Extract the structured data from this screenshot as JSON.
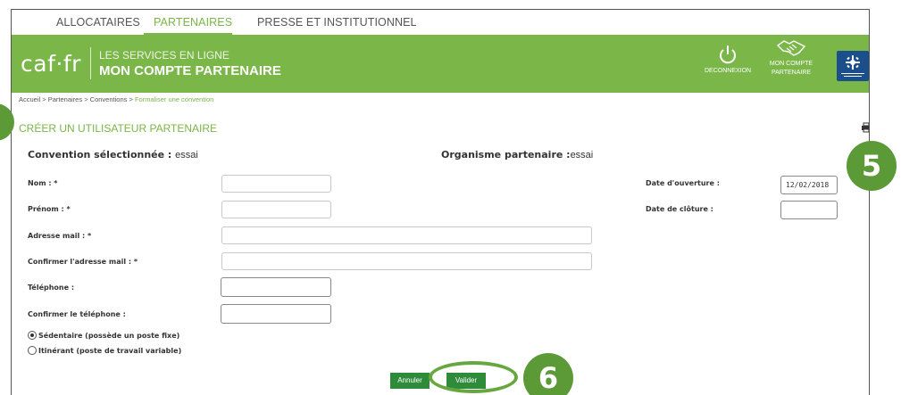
{
  "topnav": {
    "items": [
      {
        "label": "ALLOCATAIRES",
        "active": false
      },
      {
        "label": "PARTENAIRES",
        "active": true
      },
      {
        "label": "PRESSE ET INSTITUTIONNEL",
        "active": false
      }
    ]
  },
  "banner": {
    "logo": "caf·fr",
    "subtitle_small": "LES SERVICES EN LIGNE",
    "subtitle_big": "MON COMPTE PARTENAIRE",
    "logout_label": "DECONNEXION",
    "account_label_1": "MON COMPTE",
    "account_label_2": "PARTENAIRE",
    "brand_color": "#7ab648"
  },
  "breadcrumb": {
    "items": [
      "Accueil",
      "Partenaires",
      "Conventions"
    ],
    "separator": " > ",
    "current": "Formaliser une convention"
  },
  "page": {
    "title": "CRÉER UN UTILISATEUR PARTENAIRE",
    "convention_label": "Convention sélectionnée :",
    "convention_value": "essai",
    "organisme_label": "Organisme partenaire :",
    "organisme_value": "essai"
  },
  "form": {
    "nom_label": "Nom : *",
    "nom_value": "",
    "prenom_label": "Prénom : *",
    "prenom_value": "",
    "email_label": "Adresse mail : *",
    "email_value": "",
    "email_confirm_label": "Confirmer l'adresse mail : *",
    "email_confirm_value": "",
    "tel_label": "Téléphone :",
    "tel_value": "",
    "tel_confirm_label": "Confirmer le téléphone :",
    "tel_confirm_value": "",
    "date_ouverture_label": "Date d'ouverture :",
    "date_ouverture_value": "12/02/2018",
    "date_cloture_label": "Date de clôture :",
    "date_cloture_value": "",
    "radio_sedentaire": "Sédentaire (possède un poste fixe)",
    "radio_itinerant": "Itinérant (poste de travail variable)",
    "selected_radio": "sedentaire"
  },
  "actions": {
    "annuler_label": "Annuler",
    "valider_label": "Valider"
  },
  "annotations": {
    "badge_5": "5",
    "badge_6": "6"
  }
}
